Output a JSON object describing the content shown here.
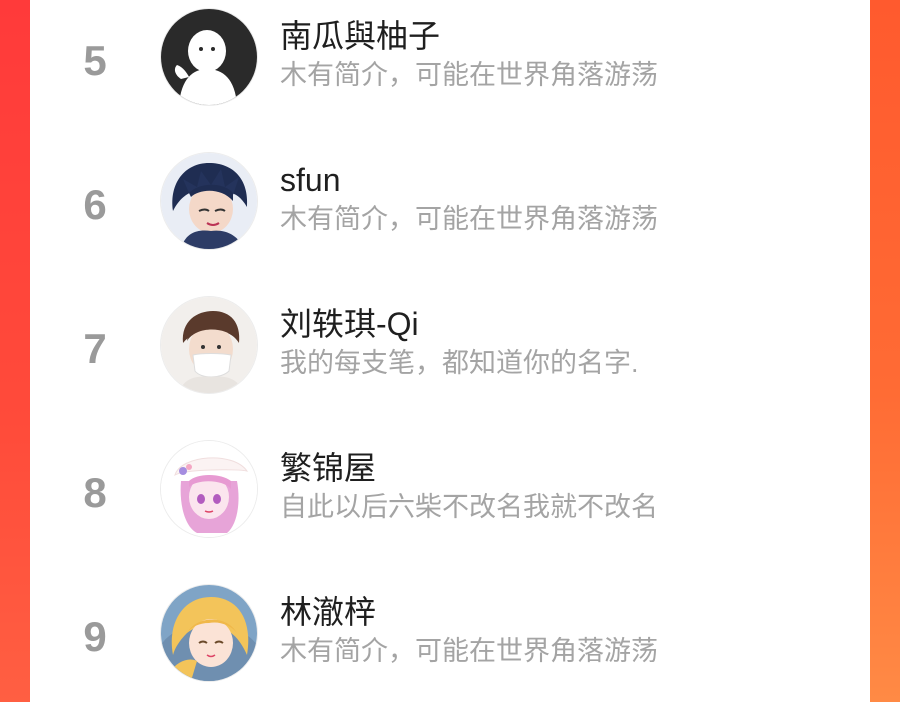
{
  "leaderboard": {
    "items": [
      {
        "rank": "5",
        "name": "南瓜與柚子",
        "bio": "木有简介，可能在世界角落游荡",
        "avatar_icon": "default-avatar-icon"
      },
      {
        "rank": "6",
        "name": "sfun",
        "bio": "木有简介，可能在世界角落游荡",
        "avatar_icon": "anime-boy-avatar-icon"
      },
      {
        "rank": "7",
        "name": "刘轶琪-Qi",
        "bio": "我的每支笔，都知道你的名字.",
        "avatar_icon": "masked-boy-avatar-icon"
      },
      {
        "rank": "8",
        "name": "繁锦屋",
        "bio": "自此以后六柴不改名我就不改名",
        "avatar_icon": "anime-girl-avatar-icon"
      },
      {
        "rank": "9",
        "name": "林澈梓",
        "bio": "木有简介，可能在世界角落游荡",
        "avatar_icon": "anime-blonde-avatar-icon"
      }
    ]
  },
  "colors": {
    "rank": "#9a9a9a",
    "name": "#1f1f1f",
    "bio": "#a4a4a4",
    "frame": "#ff4b3a"
  }
}
